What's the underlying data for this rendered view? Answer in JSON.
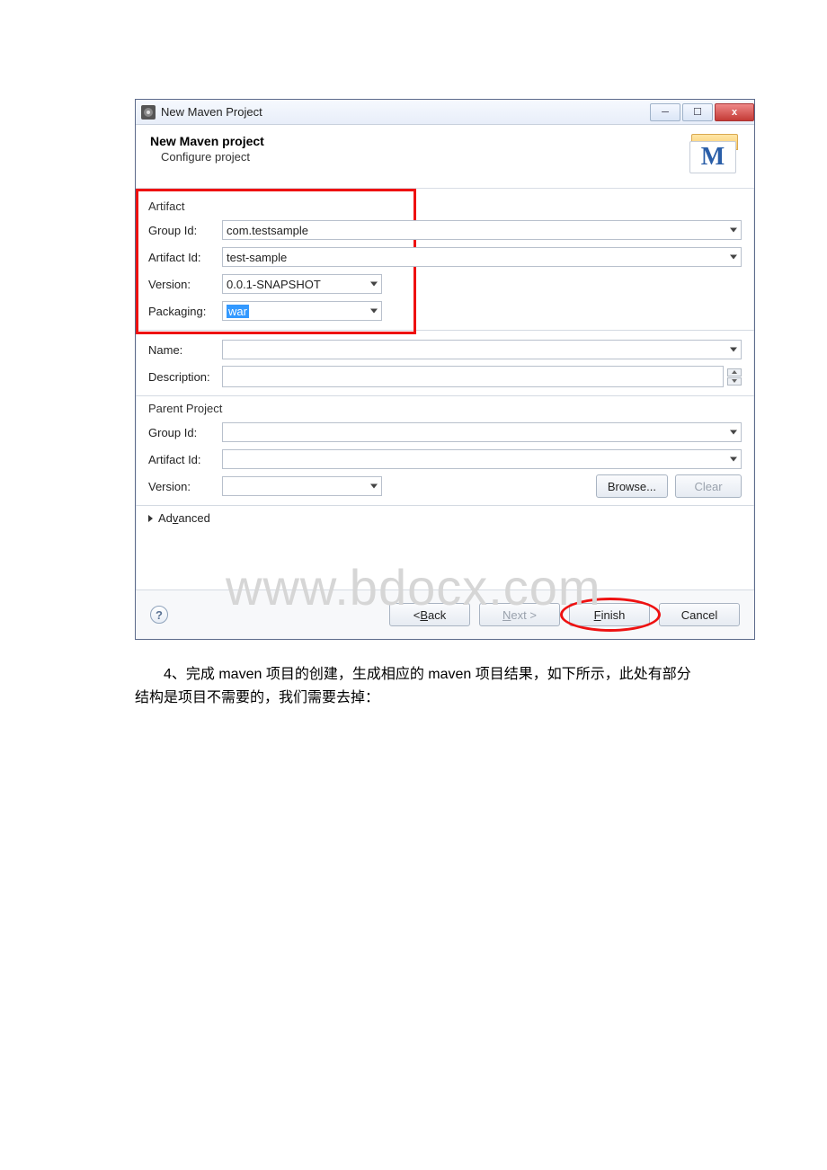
{
  "titlebar": {
    "title": "New Maven Project"
  },
  "banner": {
    "heading": "New Maven project",
    "subtitle": "Configure project",
    "icon_letter": "M"
  },
  "artifact": {
    "section": "Artifact",
    "group_id_label": "Group Id:",
    "group_id": "com.testsample",
    "artifact_id_label": "Artifact Id:",
    "artifact_id": "test-sample",
    "version_label": "Version:",
    "version": "0.0.1-SNAPSHOT",
    "packaging_label": "Packaging:",
    "packaging": "war",
    "name_label": "Name:",
    "name": "",
    "description_label": "Description:",
    "description": ""
  },
  "parent": {
    "section": "Parent Project",
    "group_id_label": "Group Id:",
    "group_id": "",
    "artifact_id_label": "Artifact Id:",
    "artifact_id": "",
    "version_label": "Version:",
    "version": "",
    "browse": "Browse...",
    "clear": "Clear"
  },
  "advanced": {
    "label": "Advanced"
  },
  "buttons": {
    "back_prefix": "< ",
    "back_u": "B",
    "back_rest": "ack",
    "next_u": "N",
    "next_rest": "ext >",
    "finish_u": "F",
    "finish_rest": "inish",
    "cancel": "Cancel"
  },
  "watermark": "www.bdocx.com",
  "caption": {
    "line1": "4、完成 maven 项目的创建，生成相应的 maven 项目结果，如下所示，此处有部分",
    "line2": "结构是项目不需要的，我们需要去掉："
  }
}
